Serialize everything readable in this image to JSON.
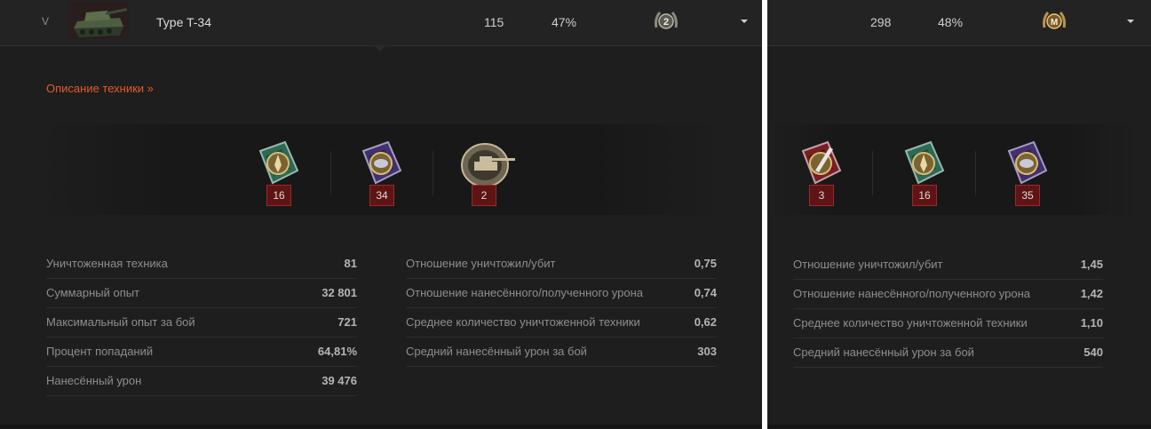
{
  "left": {
    "header": {
      "tier": "V",
      "tank_name": "Type T-34",
      "battles": "115",
      "win_rate": "47%",
      "mastery_badge": "2"
    },
    "description_link": "Описание техники »",
    "medals": [
      {
        "icon": "green-epic-medal-icon",
        "count": "16"
      },
      {
        "icon": "purple-epic-medal-icon",
        "count": "34"
      },
      {
        "icon": "tank-destroyer-badge-icon",
        "count": "2"
      }
    ],
    "stats_left": [
      {
        "label": "Уничтоженная техника",
        "value": "81"
      },
      {
        "label": "Суммарный опыт",
        "value": "32 801"
      },
      {
        "label": "Максимальный опыт за бой",
        "value": "721"
      },
      {
        "label": "Процент попаданий",
        "value": "64,81%"
      },
      {
        "label": "Нанесённый урон",
        "value": "39 476"
      }
    ],
    "stats_right": [
      {
        "label": "Отношение уничтожил/убит",
        "value": "0,75"
      },
      {
        "label": "Отношение нанесённого/полученного урона",
        "value": "0,74"
      },
      {
        "label": "Среднее количество уничтоженной техники",
        "value": "0,62"
      },
      {
        "label": "Средний нанесённый урон за бой",
        "value": "303"
      }
    ]
  },
  "right": {
    "header": {
      "battles": "298",
      "win_rate": "48%",
      "mastery_badge": "M"
    },
    "medals": [
      {
        "icon": "red-sword-medal-icon",
        "count": "3"
      },
      {
        "icon": "green-epic-medal-icon",
        "count": "16"
      },
      {
        "icon": "purple-epic-medal-icon",
        "count": "35"
      }
    ],
    "stats": [
      {
        "label": "Отношение уничтожил/убит",
        "value": "1,45"
      },
      {
        "label": "Отношение нанесённого/полученного урона",
        "value": "1,42"
      },
      {
        "label": "Среднее количество уничтоженной техники",
        "value": "1,10"
      },
      {
        "label": "Средний нанесённый урон за бой",
        "value": "540"
      }
    ]
  },
  "colors": {
    "panel_bg": "#1e1e1e",
    "accent_link": "#e45a2a",
    "count_badge": "#5e1414",
    "label_text": "#8e8e8e",
    "value_text": "#b5b5b5"
  }
}
